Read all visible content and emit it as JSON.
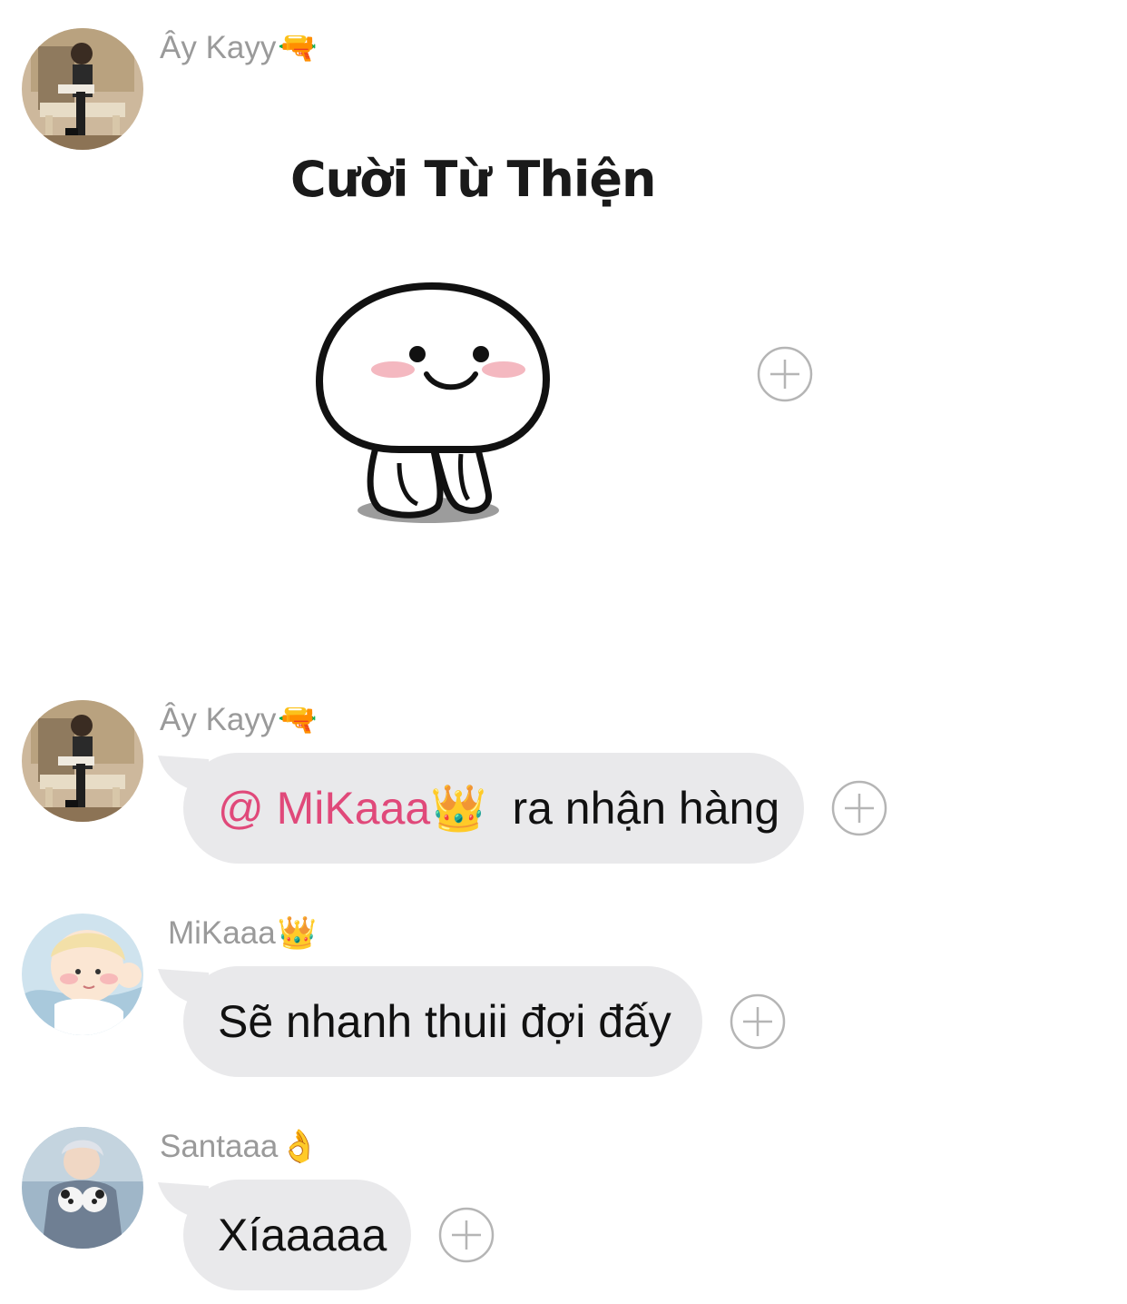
{
  "messages": [
    {
      "sender": "Ây Kayy",
      "sender_emoji": "🔫",
      "type": "sticker",
      "sticker_caption": "Cười Từ Thiện"
    },
    {
      "sender": "Ây Kayy",
      "sender_emoji": "🔫",
      "type": "text",
      "mention": "@ MiKaaa",
      "mention_emoji": "👑",
      "text": "ra nhận hàng"
    },
    {
      "sender": "MiKaaa",
      "sender_emoji": "👑",
      "type": "text",
      "text": "Sẽ nhanh thuii đợi đấy"
    },
    {
      "sender": "Santaaa",
      "sender_emoji": "👌",
      "type": "text",
      "text": "Xíaaaaa"
    }
  ],
  "icons": {
    "react_button": "plus-circle-icon"
  },
  "colors": {
    "bubble_background": "#e9e9eb",
    "sender_name": "#9a9a9a",
    "mention": "#e0497a",
    "message_text": "#111111",
    "react_button_stroke": "#b5b5b5"
  }
}
